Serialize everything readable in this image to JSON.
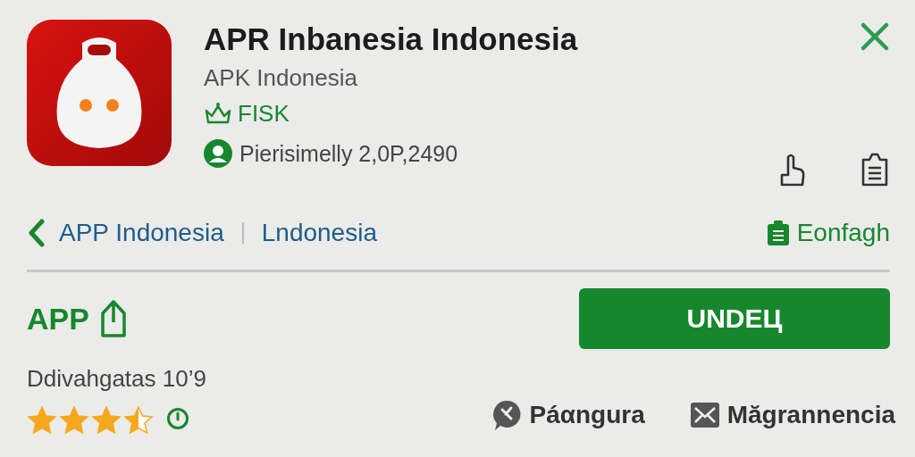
{
  "app": {
    "title": "APR Inbanesia Indonesia",
    "developer": "APK Indonesia",
    "badge": "FISK",
    "meta": "Pierisimelly 2,0P,2490"
  },
  "breadcrumb": {
    "items": [
      "APP Indonesia",
      "Lndonesia"
    ],
    "action": "Eonfagh"
  },
  "details": {
    "label": "APP",
    "version": "Ddivahgatas 10’9",
    "stars": 3.5,
    "button": "UNDEЦ",
    "actions": [
      {
        "kind": "chat",
        "label": "Páαngura"
      },
      {
        "kind": "mail",
        "label": "Măgrannencia"
      }
    ]
  }
}
